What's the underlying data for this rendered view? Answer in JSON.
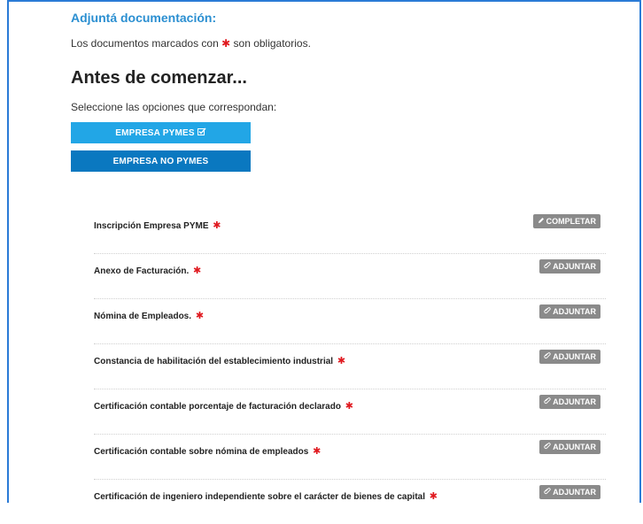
{
  "header": {
    "section_title": "Adjuntá documentación:",
    "required_note_prefix": "Los documentos marcados con",
    "required_note_suffix": "son obligatorios.",
    "required_marker": "✱"
  },
  "intro": {
    "title": "Antes de comenzar...",
    "instruction": "Seleccione las opciones que correspondan:"
  },
  "options": [
    {
      "label": "EMPRESA PYMES",
      "selected": true,
      "icon": "checkbox-checked-icon"
    },
    {
      "label": "EMPRESA NO PYMES",
      "selected": false
    }
  ],
  "documents": [
    {
      "label": "Inscripción Empresa PYME",
      "required": true,
      "action": "COMPLETAR",
      "action_icon": "pencil-icon"
    },
    {
      "label": "Anexo de Facturación.",
      "required": true,
      "action": "ADJUNTAR",
      "action_icon": "paperclip-icon"
    },
    {
      "label": "Nómina de Empleados.",
      "required": true,
      "action": "ADJUNTAR",
      "action_icon": "paperclip-icon"
    },
    {
      "label": "Constancia de habilitación del establecimiento industrial",
      "required": true,
      "action": "ADJUNTAR",
      "action_icon": "paperclip-icon"
    },
    {
      "label": "Certificación contable porcentaje de facturación declarado",
      "required": true,
      "action": "ADJUNTAR",
      "action_icon": "paperclip-icon"
    },
    {
      "label": "Certificación contable sobre nómina de empleados",
      "required": true,
      "action": "ADJUNTAR",
      "action_icon": "paperclip-icon"
    },
    {
      "label": "Certificación de ingeniero independiente sobre el carácter de bienes de capital",
      "required": true,
      "action": "ADJUNTAR",
      "action_icon": "paperclip-icon"
    }
  ],
  "colors": {
    "accent": "#2b8fd1",
    "primary_button": "#22a6e6",
    "secondary_button": "#0a78c0",
    "required_star": "#e0191f",
    "action_button": "#8a8a8a"
  }
}
